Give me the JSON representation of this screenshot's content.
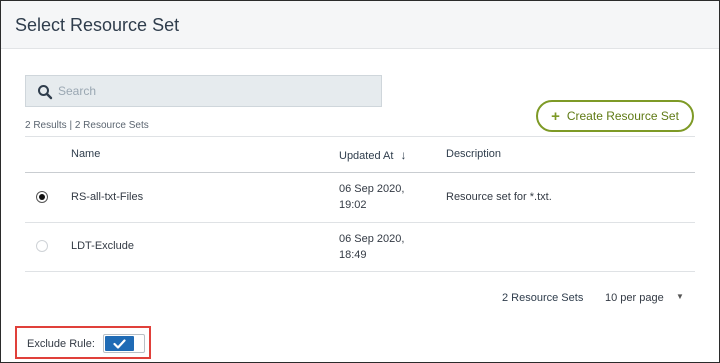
{
  "dialog": {
    "title": "Select Resource Set"
  },
  "search": {
    "placeholder": "Search",
    "value": ""
  },
  "results": {
    "summary": "2 Results | 2 Resource Sets"
  },
  "toolbar": {
    "create_label": "Create Resource Set",
    "create_icon": "plus-icon"
  },
  "table": {
    "columns": {
      "name": "Name",
      "updated_at": "Updated At",
      "description": "Description"
    },
    "sort_icon": "arrow-down-icon",
    "rows": [
      {
        "selected": true,
        "name": "RS-all-txt-Files",
        "updated_line1": "06 Sep 2020,",
        "updated_line2": "19:02",
        "description": "Resource set for *.txt."
      },
      {
        "selected": false,
        "name": "LDT-Exclude",
        "updated_line1": "06 Sep 2020,",
        "updated_line2": "18:49",
        "description": ""
      }
    ]
  },
  "pagination": {
    "count_label": "2 Resource Sets",
    "page_size": "10 per page"
  },
  "exclude_rule": {
    "label": "Exclude Rule:",
    "enabled": true
  },
  "colors": {
    "accent": "#7e9a26",
    "toggle_on": "#1f6bb5",
    "highlight": "#e0403a"
  }
}
